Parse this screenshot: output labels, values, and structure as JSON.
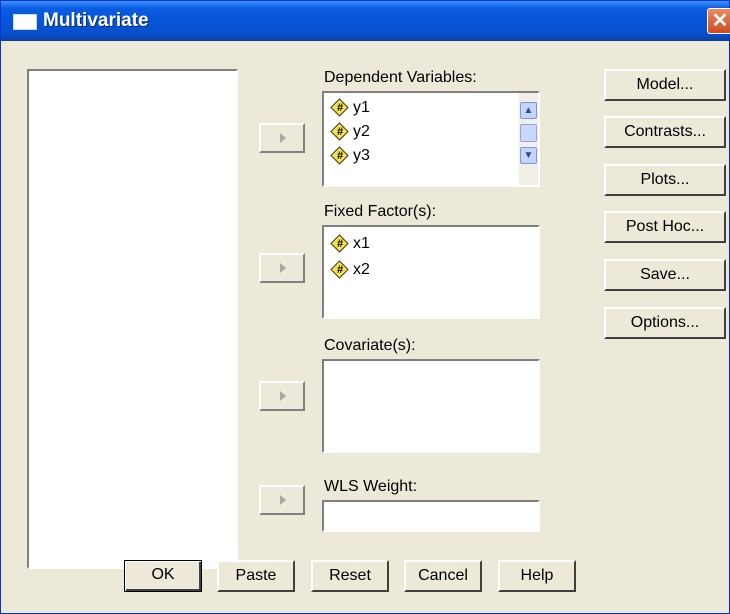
{
  "window": {
    "title": "Multivariate"
  },
  "titlebar": {
    "close_glyph": "✕"
  },
  "dependent": {
    "label": "Dependent Variables:",
    "items": [
      "y1",
      "y2",
      "y3"
    ]
  },
  "fixed": {
    "label": "Fixed Factor(s):",
    "items": [
      "x1",
      "x2"
    ]
  },
  "covariates": {
    "label": "Covariate(s):"
  },
  "wls": {
    "label": "WLS Weight:"
  },
  "side_buttons": [
    "Model...",
    "Contrasts...",
    "Plots...",
    "Post Hoc...",
    "Save...",
    "Options..."
  ],
  "bottom_buttons": [
    "OK",
    "Paste",
    "Reset",
    "Cancel",
    "Help"
  ],
  "icons": {
    "variable": "scale-variable-icon",
    "move": "move-right-arrow-icon"
  },
  "colors": {
    "titlebar": "#0654d8",
    "dialog_bg": "#ece9d8",
    "close": "#d04a1e"
  }
}
